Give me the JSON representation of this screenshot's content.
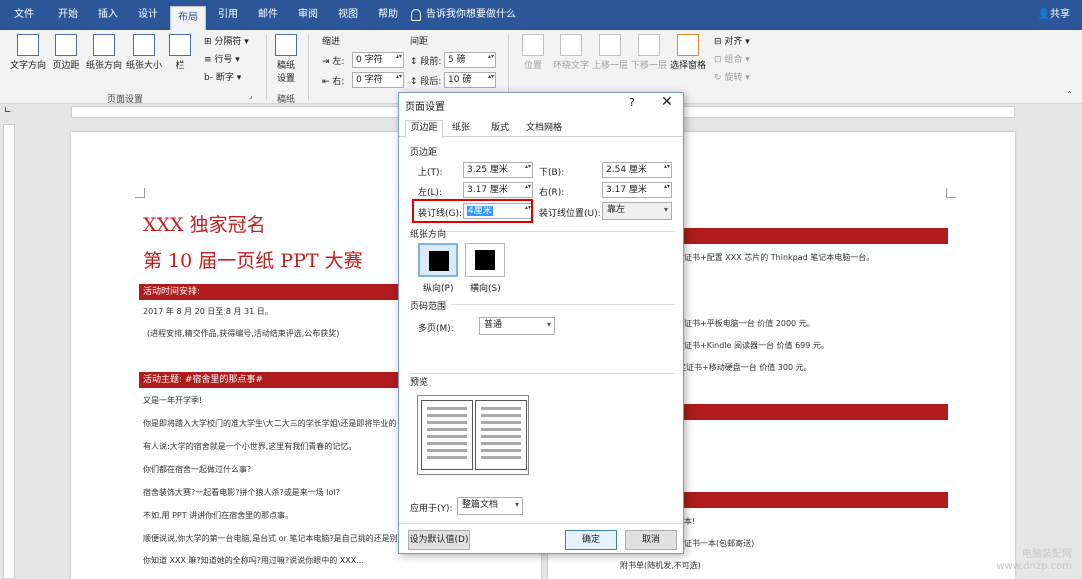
{
  "tabs": [
    "文件",
    "开始",
    "插入",
    "设计",
    "布局",
    "引用",
    "邮件",
    "审阅",
    "视图",
    "帮助"
  ],
  "active_tab": "布局",
  "tell_me": "告诉我你想要做什么",
  "share": "共享",
  "ribbon": {
    "page_setup": {
      "buttons": [
        "文字方向",
        "页边距",
        "纸张方向",
        "纸张大小",
        "栏"
      ],
      "small": [
        "分隔符",
        "行号",
        "断字"
      ],
      "label": "页面设置"
    },
    "paper": {
      "button_line1": "稿纸",
      "button_line2": "设置",
      "label": "稿纸"
    },
    "indent": {
      "title": "缩进",
      "left_label": "左:",
      "left_value": "0 字符",
      "right_label": "右:",
      "right_value": "0 字符"
    },
    "spacing": {
      "title": "间距",
      "before_label": "段前:",
      "before_value": "5 磅",
      "after_label": "段后:",
      "after_value": "10 磅"
    },
    "arrange": {
      "buttons": [
        "位置",
        "环绕文字",
        "上移一层",
        "下移一层",
        "选择窗格"
      ],
      "small": [
        "对齐",
        "组合",
        "旋转"
      ]
    }
  },
  "document": {
    "title1": "XXX 独家冠名",
    "title2": "第 10 届一页纸 PPT 大赛",
    "bar1": "活动时间安排:",
    "date": "2017 年 8 月 20 日至 8 月 31 日。",
    "process": "(进程安排,精交作品,获得编号,活动结束评选,公布获奖)",
    "bar2": "活动主题: #宿舍里的那点事#",
    "lines": [
      "又是一年开学季!",
      "你是即将踏入大学校门的准大学生\\大二大三的学长学姐\\还是即将毕业的",
      "有人说:大学的宿舍就是一个小世界,这里有我们青春的记忆。",
      "你们都在宿舍一起做过什么事?",
      "宿舍装饰大赛?一起看电影?拼个狼人杀?或是来一场 lol?",
      "不如,用 PPT 讲讲你们在宿舍里的那点事。",
      "顺便说说,你大学的第一台电脑,是台式 or 笔记本电脑?是自己挑的还是别",
      "你知道 XXX 嘛?知道她的全称吗?用过嘛?说说你眼中的 XXX..."
    ],
    "right_lines": [
      "证书+配置 XXX 芯片的 Thinkpad 笔记本电脑一台。",
      "证书+平板电脑一台  价值 2000 元。",
      "证书+Kindle 阅读器一台  价值 699 元。",
      "奖证书+移动硬盘一台   价值 300 元。",
      "本!",
      "证书一本(包邮寄送)",
      "附书单(随机发,不可选)"
    ]
  },
  "dialog": {
    "title": "页面设置",
    "help": "?",
    "close": "✕",
    "tabs": [
      "页边距",
      "纸张",
      "版式",
      "文档网格"
    ],
    "margins_title": "页边距",
    "top_label": "上(T):",
    "top_value": "3.25 厘米",
    "bottom_label": "下(B):",
    "bottom_value": "2.54 厘米",
    "left_label": "左(L):",
    "left_value": "3.17 厘米",
    "right_label": "右(R):",
    "right_value": "3.17 厘米",
    "gutter_label": "装订线(G):",
    "gutter_value": "4厘米",
    "gutter_pos_label": "装订线位置(U):",
    "gutter_pos_value": "靠左",
    "orientation_title": "纸张方向",
    "portrait": "纵向(P)",
    "landscape": "横向(S)",
    "pages_title": "页码范围",
    "multi_label": "多页(M):",
    "multi_value": "普通",
    "preview_title": "预览",
    "apply_label": "应用于(Y):",
    "apply_value": "整篇文档",
    "default_btn": "设为默认值(D)",
    "ok_btn": "确定",
    "cancel_btn": "取消"
  },
  "watermark": {
    "line1": "电脑装配网",
    "line2": "www.dnzp.com"
  }
}
